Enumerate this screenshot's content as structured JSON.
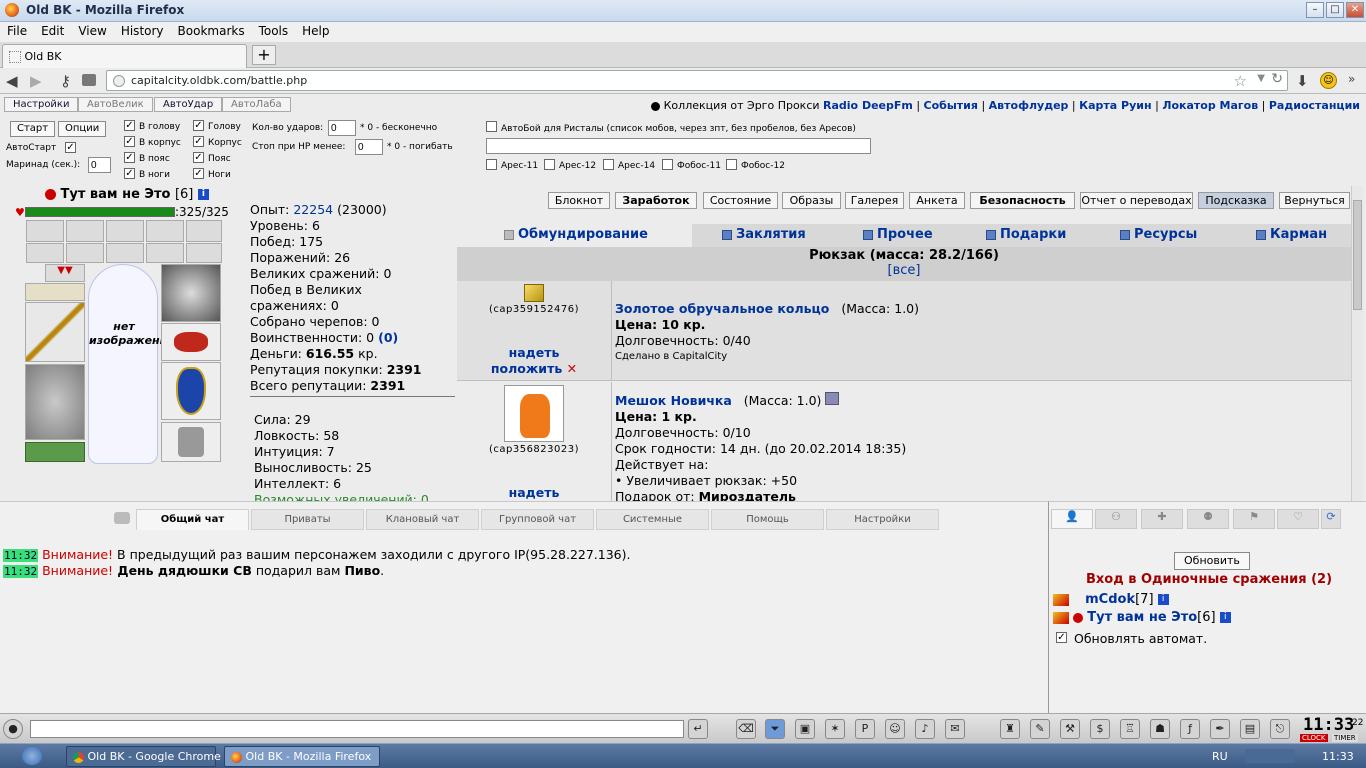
{
  "window": {
    "title": "Old BK - Mozilla Firefox",
    "minimize": "–",
    "maximize": "□",
    "close": "✕"
  },
  "menu": [
    "File",
    "Edit",
    "View",
    "History",
    "Bookmarks",
    "Tools",
    "Help"
  ],
  "tab": {
    "label": "Old BK",
    "new_tab": "+"
  },
  "url": "capitalcity.oldbk.com/battle.php",
  "toolbar1": {
    "buttons": [
      "Настройки",
      "АвтоВелик",
      "АвтоУдар",
      "АвтоЛаба"
    ],
    "right_prefix": "Коллекция от Эрго Прокси",
    "right_links": [
      "Radio DeepFm",
      "События",
      "Автофлудер",
      "Карта Руин",
      "Локатор Магов",
      "Радиостанции"
    ]
  },
  "options": {
    "start_label": "Старт",
    "opts_label": "Опции",
    "autostart_label": "АвтоСтарт",
    "marinad_label": "Маринад (сек.):",
    "marinad_value": "0",
    "hit_checks_a": [
      "В голову",
      "В корпус",
      "В пояс",
      "В ноги"
    ],
    "hit_checks_b": [
      "Голову",
      "Корпус",
      "Пояс",
      "Ноги"
    ],
    "hits_label": "Кол-во ударов:",
    "hits_value": "0",
    "hits_hint": "* 0 - бесконечно",
    "stop_label": "Стоп при HP менее:",
    "stop_value": "0",
    "stop_hint": "* 0 - погибать",
    "autobattle_label": "АвтоБой для Ристалы (список мобов, через зпт, без пробелов, без Аресов)",
    "mob_checks": [
      "Арес-11",
      "Арес-12",
      "Арес-14",
      "Фобос-11",
      "Фобос-12"
    ]
  },
  "character": {
    "name": "Тут вам не Это",
    "level_bracket": "[6]",
    "hp": ":325/325",
    "hp_fraction": 1.0,
    "no_image": "нет изображения"
  },
  "stats": {
    "exp_label": "Опыт:",
    "exp_value": "22254",
    "exp_next": "(23000)",
    "lines_a": [
      "Уровень: 6",
      "Побед: 175",
      "Поражений: 26",
      "Великих сражений: 0",
      "Побед в Великих",
      "сражениях: 0",
      "Собрано черепов: 0"
    ],
    "valor_label": "Воинственности: 0",
    "valor_extra": "(0)",
    "money_label": "Деньги:",
    "money_value": "616.55",
    "money_unit": "кр.",
    "rep_buy_label": "Репутация покупки:",
    "rep_buy_value": "2391",
    "rep_total_label": "Всего репутации:",
    "rep_total_value": "2391",
    "lines_b": [
      "Сила: 29",
      "Ловкость: 58",
      "Интуиция: 7",
      "Выносливость: 25",
      "Интеллект: 6"
    ],
    "upgrades": "Возможных увеличений: 0"
  },
  "panel_buttons": [
    "Блокнот",
    "Заработок",
    "Состояние",
    "Образы",
    "Галерея",
    "Анкета",
    "Безопасность",
    "Отчет о переводах",
    "Подсказка",
    "Вернуться"
  ],
  "inventory_tabs": [
    "Обмундирование",
    "Заклятия",
    "Прочее",
    "Подарки",
    "Ресурсы",
    "Карман"
  ],
  "backpack": {
    "title": "Рюкзак (масса: 28.2/166)",
    "all_link": "[все]"
  },
  "items": [
    {
      "code": "(cap359152476)",
      "name": "Золотое обручальное кольцо",
      "mass": "(Масса: 1.0)",
      "price_label": "Цена: 10 кр.",
      "durability": "Долговечность: 0/40",
      "made": "Сделано в CapitalCity",
      "wear": "надеть",
      "put": "положить"
    },
    {
      "code": "(cap356823023)",
      "name": "Мешок Новичка",
      "mass": "(Масса: 1.0)",
      "price_label": "Цена: 1 кр.",
      "durability": "Долговечность: 0/10",
      "expiry": "Срок годности: 14 дн. (до 20.02.2014 18:35)",
      "acts": "Действует на:",
      "effect": "• Увеличивает рюкзак: +50",
      "gift_label": "Подарок от:",
      "gift_from": "Мироздатель",
      "wear": "надеть"
    }
  ],
  "chat_tabs": [
    "Общий чат",
    "Приваты",
    "Клановый чат",
    "Групповой чат",
    "Системные",
    "Помощь",
    "Настройки"
  ],
  "messages": [
    {
      "time": "11:32",
      "warn": "Внимание!",
      "text": " В предыдущий раз вашим персонажем заходили с другого IP(95.28.227.136)."
    },
    {
      "time": "11:32",
      "warn": "Внимание!",
      "bold1": " День дядюшки СВ",
      "text": " подарил вам ",
      "bold2": "Пиво",
      "end": "."
    }
  ],
  "right_chat": {
    "refresh": "Обновить",
    "battle_title": "Вход в Одиночные сражения (2)",
    "players": [
      {
        "name": "mCdok",
        "lvl": "[7]"
      },
      {
        "name": "Тут вам не Это",
        "lvl": "[6]"
      }
    ],
    "auto_label": "Обновлять автомат."
  },
  "clock": {
    "time": "11:33",
    "seconds": "22",
    "clock_label": "CLOCK",
    "timer_label": "TIMER"
  },
  "taskbar": {
    "tasks": [
      "Old BK - Google Chrome",
      "Old BK - Mozilla Firefox"
    ],
    "lang": "RU",
    "time": "11:33"
  },
  "colors": {
    "accent_blue": "#003399",
    "hp_green": "#1a8a1a",
    "timestamp_green": "#39e07a",
    "warn_red": "#cc0000"
  }
}
